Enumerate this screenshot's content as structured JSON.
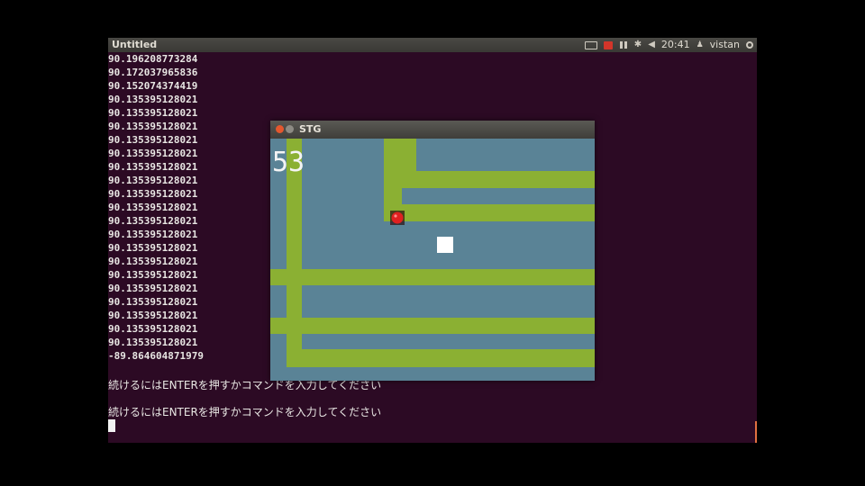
{
  "desktop": {
    "window_title": "Untitled",
    "clock": "20:41",
    "user": "vistan"
  },
  "terminal": {
    "numbers": [
      "90.196208773284",
      "90.172037965836",
      "90.152074374419",
      "90.135395128021",
      "90.135395128021",
      "90.135395128021",
      "90.135395128021",
      "90.135395128021",
      "90.135395128021",
      "90.135395128021",
      "90.135395128021",
      "90.135395128021",
      "90.135395128021",
      "90.135395128021",
      "90.135395128021",
      "90.135395128021",
      "90.135395128021",
      "90.135395128021",
      "90.135395128021",
      "90.135395128021",
      "90.135395128021",
      "90.135395128021",
      "-89.864604871979"
    ],
    "messages": [
      "続けるにはENTERを押すかコマンドを入力してください",
      "続けるにはENTERを押すかコマンドを入力してください"
    ]
  },
  "game": {
    "title": "STG",
    "score": "53",
    "colors": {
      "background": "#5a8396",
      "track": "#8bb033",
      "player": "#e02020",
      "target": "#ffffff"
    }
  }
}
